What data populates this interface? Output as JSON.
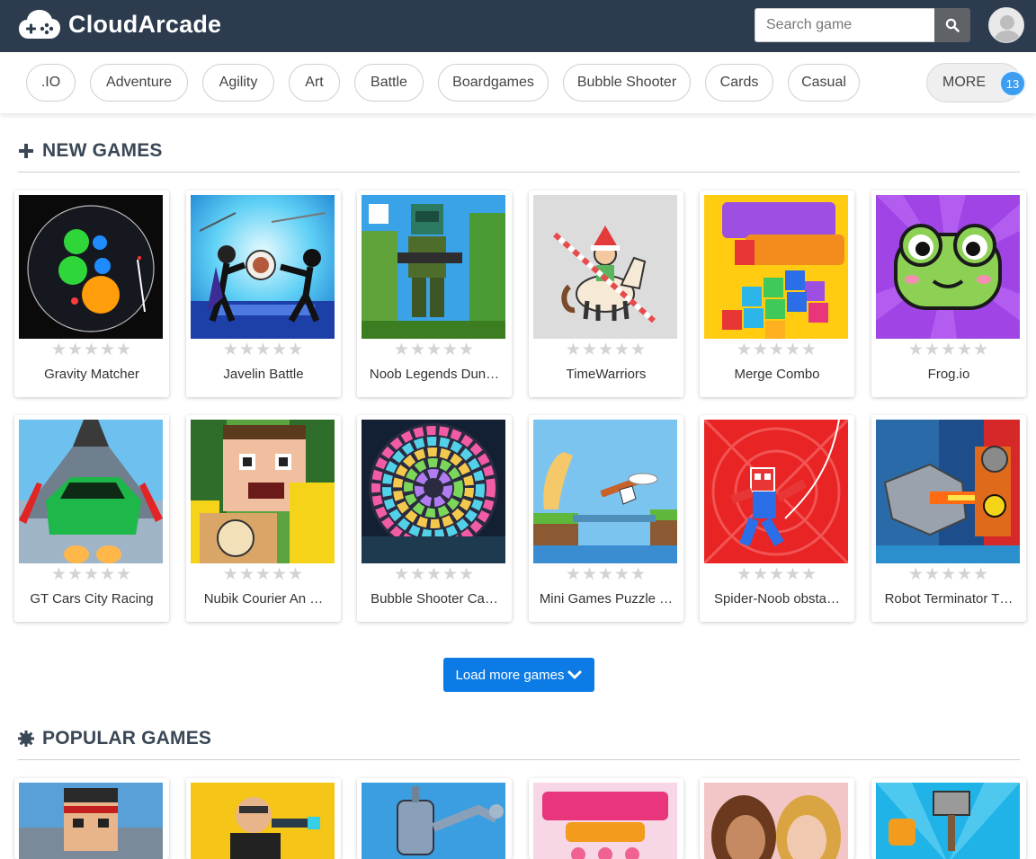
{
  "header": {
    "brand": "CloudArcade",
    "search_placeholder": "Search game",
    "search_icon": "search-icon",
    "avatar_icon": "user-avatar-icon",
    "bg_color": "#2c3b4e"
  },
  "categories": {
    "items": [
      ".IO",
      "Adventure",
      "Agility",
      "Art",
      "Battle",
      "Boardgames",
      "Bubble Shooter",
      "Cards",
      "Casual"
    ],
    "more_label": "MORE",
    "more_count": "13"
  },
  "new_games": {
    "title": "NEW GAMES",
    "icon": "plus-icon",
    "games": [
      {
        "title": "Gravity Matcher",
        "rating": 0
      },
      {
        "title": "Javelin Battle",
        "rating": 0
      },
      {
        "title": "Noob Legends Dun…",
        "rating": 0
      },
      {
        "title": "TimeWarriors",
        "rating": 0
      },
      {
        "title": "Merge Combo",
        "rating": 0
      },
      {
        "title": "Frog.io",
        "rating": 0
      },
      {
        "title": "GT Cars City Racing",
        "rating": 0
      },
      {
        "title": "Nubik Courier An …",
        "rating": 0
      },
      {
        "title": "Bubble Shooter Ca…",
        "rating": 0
      },
      {
        "title": "Mini Games Puzzle …",
        "rating": 0
      },
      {
        "title": "Spider-Noob obsta…",
        "rating": 0
      },
      {
        "title": "Robot Terminator T…",
        "rating": 0
      }
    ],
    "stars": "★★★★★"
  },
  "load_more_label": "Load more games",
  "popular_games": {
    "title": "POPULAR GAMES",
    "icon": "gear-icon"
  },
  "colors": {
    "accent": "#0d7be6",
    "badge": "#3d9df0"
  }
}
